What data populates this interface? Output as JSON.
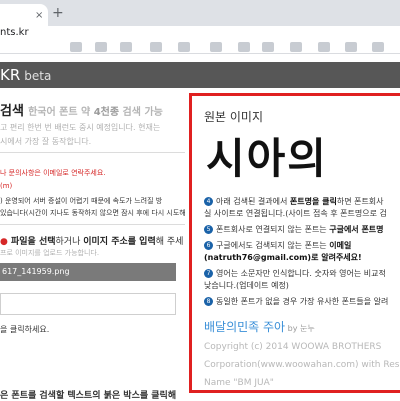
{
  "browser": {
    "tab_close": "×",
    "new_tab": "+",
    "url": "nts.kr"
  },
  "header": {
    "logo": "KR",
    "beta": "beta"
  },
  "left": {
    "title_main": "검색",
    "title_sub": "한국어 폰트 약 ",
    "title_sub_bold": "4천종",
    "title_sub_end": " 검색 가능",
    "grey1": "고 편리 한번 번 배런도 중시 예정입니다. 현재는",
    "grey2": "시에서 가장 잘 동작합니다.",
    "red1": "나 문의사항은 이메일로 연락주세요.",
    "red2": "(m)",
    "dark1": ") 운영되어 서버 증설이 어렵기 때문에 속도가 느려질 방",
    "dark2": "있습니다(시간이 지나도 동작하지 않으면 잠시 후에 다시 시도해주세요.",
    "upload_prefix": " 파일을 선택",
    "upload_mid": "하거나 ",
    "upload_bold2": "이미지 주소를 입력",
    "upload_end": "해 주세",
    "upload_note": "프로 이미지를 업로드 가능합니다.",
    "file_name": "617_141959.png",
    "click_hint": "을 클릭하세요.",
    "bottom_hint": "은 폰트를 검색할 텍스트의 붉은 박스를 클릭해"
  },
  "preview": {
    "title": "원본 이미지",
    "sample_text": "시아의",
    "info": [
      {
        "n": "4",
        "text": "아래 검색된 결과에서 ",
        "bold": "폰트명을 클릭",
        "tail": "하면 폰트회사"
      },
      {
        "n": "",
        "text": "실 사이트로 연결됩니다.(사이트 접속 후 폰트명으로 검",
        "bold": "",
        "tail": ""
      },
      {
        "n": "5",
        "text": "폰트회사로 연결되지 않는 폰트는 ",
        "bold": "구글에서 폰트명",
        "tail": ""
      },
      {
        "n": "6",
        "text": "구글에서도 검색되지 않는 폰트는 ",
        "bold": "이메일",
        "tail": ""
      },
      {
        "n": "",
        "text": "",
        "bold": "(natruth76@gmail.com)로 알려주세요!",
        "tail": ""
      },
      {
        "n": "7",
        "text": "영어는 소문자만 인식합니다. 숫자와 영어는 비교적",
        "bold": "",
        "tail": ""
      },
      {
        "n": "",
        "text": "낮습니다.(업데이트 예정)",
        "bold": "",
        "tail": ""
      },
      {
        "n": "8",
        "text": "동일한 폰트가 없을 경우 가장 유사한 폰트들을 알려",
        "bold": "",
        "tail": ""
      }
    ],
    "font_name": "배달의민족 주아",
    "font_by": " by 눈누",
    "copy1": "Copyright (c) 2014 WOOWA BROTHERS",
    "copy2": "Corporation(www.woowahan.com) with Res",
    "copy3": "Name \"BM JUA\""
  }
}
